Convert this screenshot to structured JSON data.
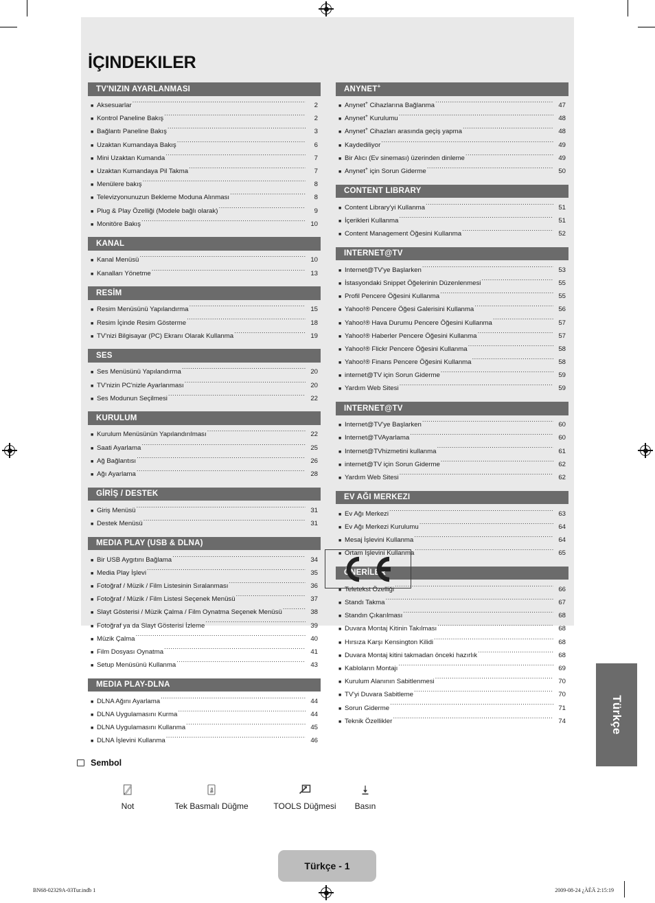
{
  "page": {
    "title": "İÇINDEKILER",
    "page_label": "Türkçe - 1",
    "language_tab": "Türkçe",
    "ce_mark": "CE"
  },
  "footer": {
    "left": "BN68-02329A-03Tur.indb   1",
    "right": "2009-08-24   ¿ÀÈÄ 2:15:19"
  },
  "symbols": {
    "heading": "Sembol",
    "items": [
      {
        "icon": "note-icon",
        "label": "Not"
      },
      {
        "icon": "one-touch-button-icon",
        "label": "Tek Basmalı Düğme"
      },
      {
        "icon": "tools-button-icon",
        "label": "TOOLS Düğmesi"
      },
      {
        "icon": "press-icon",
        "label": "Basın"
      }
    ]
  },
  "toc": {
    "left_column": [
      {
        "heading": "TV'NIZIN AYARLANMASI",
        "entries": [
          {
            "label": "Aksesuarlar",
            "page": "2"
          },
          {
            "label": "Kontrol Paneline Bakış",
            "page": "2"
          },
          {
            "label": "Bağlantı Paneline Bakış",
            "page": "3"
          },
          {
            "label": "Uzaktan Kumandaya Bakış",
            "page": "6"
          },
          {
            "label": "Mini Uzaktan Kumanda",
            "page": "7"
          },
          {
            "label": "Uzaktan Kumandaya Pil Takma",
            "page": "7"
          },
          {
            "label": "Menülere bakış",
            "page": "8"
          },
          {
            "label": "Televizyonunuzun Bekleme Moduna Alınması",
            "page": "8"
          },
          {
            "label": "Plug & Play Özelliği (Modele bağlı olarak)",
            "page": "9"
          },
          {
            "label": "Monitöre Bakış",
            "page": "10"
          }
        ]
      },
      {
        "heading": "KANAL",
        "entries": [
          {
            "label": "Kanal Menüsü",
            "page": "10"
          },
          {
            "label": "Kanalları Yönetme",
            "page": "13"
          }
        ]
      },
      {
        "heading": "RESİM",
        "entries": [
          {
            "label": "Resim Menüsünü Yapılandırma",
            "page": "15"
          },
          {
            "label": "Resim İçinde Resim Gösterme",
            "page": "18"
          },
          {
            "label": "TV'nizi Bilgisayar (PC) Ekranı Olarak Kullanma",
            "page": "19"
          }
        ]
      },
      {
        "heading": "SES",
        "entries": [
          {
            "label": "Ses Menüsünü Yapılandırma",
            "page": "20"
          },
          {
            "label": "TV'nizin PC'nizle Ayarlanması",
            "page": "20"
          },
          {
            "label": "Ses Modunun Seçilmesi",
            "page": "22"
          }
        ]
      },
      {
        "heading": "KURULUM",
        "entries": [
          {
            "label": "Kurulum Menüsünün Yapılandırılması",
            "page": "22"
          },
          {
            "label": "Saati Ayarlama",
            "page": "25"
          },
          {
            "label": "Ağ Bağlantısı",
            "page": "26"
          },
          {
            "label": "Ağı Ayarlama",
            "page": "28"
          }
        ]
      },
      {
        "heading": "GİRİŞ / DESTEK",
        "entries": [
          {
            "label": "Giriş Menüsü",
            "page": "31"
          },
          {
            "label": "Destek Menüsü",
            "page": "31"
          }
        ]
      },
      {
        "heading": "MEDIA PLAY (USB & DLNA)",
        "entries": [
          {
            "label": "Bir USB Aygıtını Bağlama",
            "page": "34"
          },
          {
            "label": "Media Play İşlevi",
            "page": "35"
          },
          {
            "label": "Fotoğraf / Müzik / Film Listesinin Sıralanması",
            "page": "36"
          },
          {
            "label": "Fotoğraf / Müzik / Film Listesi Seçenek Menüsü",
            "page": "37"
          },
          {
            "label": "Slayt Gösterisi / Müzik Çalma / Film Oynatma Seçenek Menüsü",
            "page": "38"
          },
          {
            "label": "Fotoğraf ya da Slayt Gösterisi İzleme",
            "page": "39"
          },
          {
            "label": "Müzik Çalma",
            "page": "40"
          },
          {
            "label": "Film Dosyası Oynatma",
            "page": "41"
          },
          {
            "label": "Setup Menüsünü Kullanma",
            "page": "43"
          }
        ]
      },
      {
        "heading": "MEDIA PLAY-DLNA",
        "entries": [
          {
            "label": "DLNA Ağını Ayarlama",
            "page": "44"
          },
          {
            "label": "DLNA Uygulamasını Kurma",
            "page": "44"
          },
          {
            "label": "DLNA Uygulamasını Kullanma",
            "page": "45"
          },
          {
            "label": "DLNA İşlevini Kullanma",
            "page": "46"
          }
        ]
      }
    ],
    "right_column": [
      {
        "heading": "ANYNET+",
        "heading_sup": "+",
        "heading_base": "ANYNET",
        "entries": [
          {
            "label": "Anynet+ Cihazlarına Bağlanma",
            "page": "47",
            "sup_after": "Anynet"
          },
          {
            "label": "Anynet+ Kurulumu",
            "page": "48",
            "sup_after": "Anynet"
          },
          {
            "label": "Anynet+ Cihazları arasında geçiş yapma",
            "page": "48",
            "sup_after": "Anynet"
          },
          {
            "label": "Kaydediliyor",
            "page": "49"
          },
          {
            "label": "Bir Alıcı (Ev sineması) üzerinden dinleme",
            "page": "49"
          },
          {
            "label": "Anynet+ için Sorun Giderme",
            "page": "50",
            "sup_after": "Anynet"
          }
        ]
      },
      {
        "heading": "CONTENT LIBRARY",
        "entries": [
          {
            "label": "Content Library'yi Kullanma",
            "page": "51"
          },
          {
            "label": "İçerikleri Kullanma",
            "page": "51"
          },
          {
            "label": "Content Management Öğesini Kullanma",
            "page": "52"
          }
        ]
      },
      {
        "heading": "INTERNET@TV",
        "entries": [
          {
            "label": "Internet@TV'ye Başlarken",
            "page": "53"
          },
          {
            "label": "İstasyondaki Snippet Öğelerinin Düzenlenmesi",
            "page": "55"
          },
          {
            "label": "Profil Pencere Öğesini Kullanma",
            "page": "55"
          },
          {
            "label": "Yahoo!® Pencere Öğesi Galerisini Kullanma",
            "page": "56"
          },
          {
            "label": "Yahoo!® Hava Durumu Pencere Öğesini Kullanma",
            "page": "57"
          },
          {
            "label": "Yahoo!® Haberler Pencere Öğesini Kullanma",
            "page": "57"
          },
          {
            "label": "Yahoo!® Flickr Pencere Öğesini Kullanma",
            "page": "58"
          },
          {
            "label": "Yahoo!® Finans Pencere Öğesini Kullanma",
            "page": "58"
          },
          {
            "label": "internet@TV için Sorun Giderme",
            "page": "59"
          },
          {
            "label": "Yardım Web Sitesi",
            "page": "59"
          }
        ]
      },
      {
        "heading": "INTERNET@TV",
        "entries": [
          {
            "label": "Internet@TV'ye Başlarken",
            "page": "60"
          },
          {
            "label": "Internet@TVAyarlama",
            "page": "60"
          },
          {
            "label": "Internet@TVhizmetini kullanma",
            "page": "61"
          },
          {
            "label": "internet@TV için Sorun Giderme",
            "page": "62"
          },
          {
            "label": "Yardım Web Sitesi",
            "page": "62"
          }
        ]
      },
      {
        "heading": "EV AĞI MERKEZI",
        "entries": [
          {
            "label": "Ev Ağı Merkezi",
            "page": "63"
          },
          {
            "label": "Ev Ağı Merkezi Kurulumu",
            "page": "64"
          },
          {
            "label": "Mesaj İşlevini Kullanma",
            "page": "64"
          },
          {
            "label": "Ortam İşlevini Kullanma",
            "page": "65"
          }
        ]
      },
      {
        "heading": "ÖNERİLER",
        "entries": [
          {
            "label": "Teletekst Özelliği",
            "page": "66"
          },
          {
            "label": "Standı Takma",
            "page": "67"
          },
          {
            "label": "Standın Çıkarılması",
            "page": "68"
          },
          {
            "label": "Duvara Montaj Kitinin Takılması",
            "page": "68"
          },
          {
            "label": "Hırsıza Karşı Kensington Kilidi",
            "page": "68"
          },
          {
            "label": "Duvara Montaj kitini takmadan önceki hazırlık",
            "page": "68"
          },
          {
            "label": "Kabloların Montajı",
            "page": "69"
          },
          {
            "label": "Kurulum Alanının Sabitlenmesi",
            "page": "70"
          },
          {
            "label": "TV'yi Duvara Sabitleme",
            "page": "70"
          },
          {
            "label": "Sorun Giderme",
            "page": "71"
          },
          {
            "label": "Teknik Özellikler",
            "page": "74"
          }
        ]
      }
    ]
  },
  "colors": {
    "section_header_bg": "#6b6b6b",
    "page_bg": "#e9e9e9",
    "pill_bg": "#bdbdbd"
  }
}
